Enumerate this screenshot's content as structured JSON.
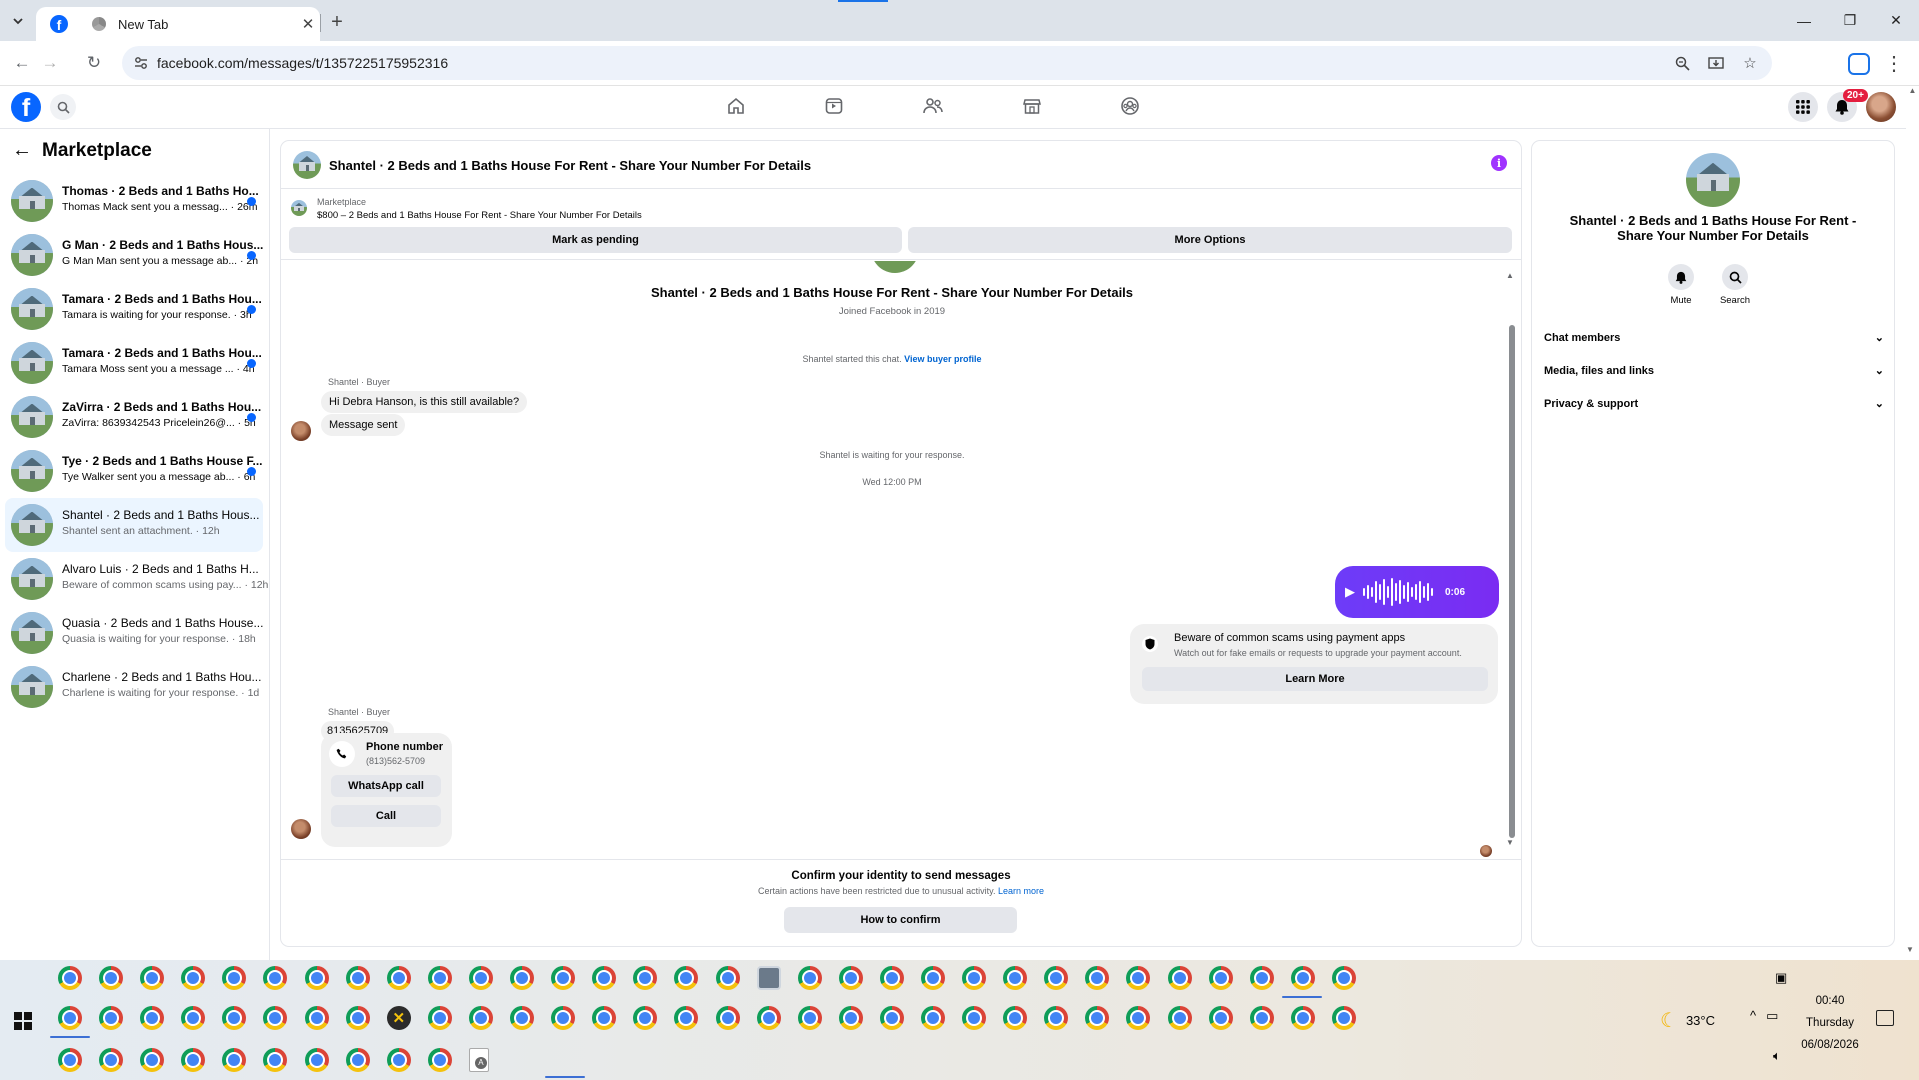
{
  "browser": {
    "tabs": [
      {
        "label": "",
        "favicon": "facebook-icon",
        "active": true
      },
      {
        "label": "New Tab",
        "favicon": "chrome-icon",
        "active": false
      }
    ],
    "url": "facebook.com/messages/t/1357225175952316"
  },
  "fb": {
    "logo": "f",
    "notification_badge": "20+"
  },
  "sidebar": {
    "title": "Marketplace",
    "conversations": [
      {
        "title": "Thomas · 2 Beds and 1 Baths Ho...",
        "preview": "Thomas Mack sent you a messag... · 26m",
        "unread": true
      },
      {
        "title": "G Man · 2 Beds and 1 Baths Hous...",
        "preview": "G Man Man sent you a message ab... · 2h",
        "unread": true
      },
      {
        "title": "Tamara · 2 Beds and 1 Baths Hou...",
        "preview": "Tamara is waiting for your response. · 3h",
        "unread": true
      },
      {
        "title": "Tamara · 2 Beds and 1 Baths Hou...",
        "preview": "Tamara Moss sent you a message ... · 4h",
        "unread": true
      },
      {
        "title": "ZaVirra · 2 Beds and 1 Baths Hou...",
        "preview": "ZaVirra: 8639342543 Pricelein26@... · 5h",
        "unread": true
      },
      {
        "title": "Tye · 2 Beds and 1 Baths House F...",
        "preview": "Tye Walker sent you a message ab... · 6h",
        "unread": true
      },
      {
        "title": "Shantel · 2 Beds and 1 Baths Hous...",
        "preview": "Shantel sent an attachment. · 12h",
        "unread": false,
        "active": true
      },
      {
        "title": "Alvaro Luis · 2 Beds and 1 Baths H...",
        "preview": "Beware of common scams using pay... · 12h",
        "unread": false
      },
      {
        "title": "Quasia · 2 Beds and 1 Baths House...",
        "preview": "Quasia is waiting for your response. · 18h",
        "unread": false
      },
      {
        "title": "Charlene · 2 Beds and 1 Baths Hou...",
        "preview": "Charlene is waiting for your response. · 1d",
        "unread": false
      }
    ]
  },
  "chat": {
    "title": "Shantel · 2 Beds and 1 Baths House For Rent - Share Your Number For Details",
    "listing_label": "Marketplace",
    "listing_text": "$800 – 2 Beds and 1 Baths House For Rent - Share Your Number For Details",
    "mark_pending": "Mark as pending",
    "more_options": "More Options",
    "conv_name": "Shantel · 2 Beds and 1 Baths House For Rent - Share Your Number For Details",
    "joined": "Joined Facebook in 2019",
    "started_text": "Shantel started this chat.",
    "view_buyer_profile": "View buyer profile",
    "sender_label_1": "Shantel · Buyer",
    "msg_1": "Hi Debra Hanson, is this still available?",
    "msg_2": "Message sent",
    "waiting": "Shantel is waiting for your response.",
    "timestamp": "Wed 12:00 PM",
    "voice_duration": "0:06",
    "scam_title": "Beware of common scams using payment apps",
    "scam_body": "Watch out for fake emails or requests to upgrade your payment account.",
    "learn_more_btn": "Learn More",
    "sender_label_2": "Shantel · Buyer",
    "msg_3": "8135625709",
    "phone_title": "Phone number",
    "phone_value": "(813)562-5709",
    "whatsapp_call": "WhatsApp call",
    "call": "Call",
    "confirm_title": "Confirm your identity to send messages",
    "confirm_body": "Certain actions have been restricted due to unusual activity.",
    "confirm_learn": "Learn more",
    "confirm_button": "How to confirm"
  },
  "details": {
    "name": "Shantel · 2 Beds and 1 Baths House For Rent - Share Your Number For Details",
    "mute": "Mute",
    "search": "Search",
    "sections": [
      "Chat members",
      "Media, files and links",
      "Privacy & support"
    ]
  },
  "taskbar": {
    "temperature": "33°C",
    "time": "00:40",
    "day": "Thursday",
    "date": "06/08/2026"
  }
}
